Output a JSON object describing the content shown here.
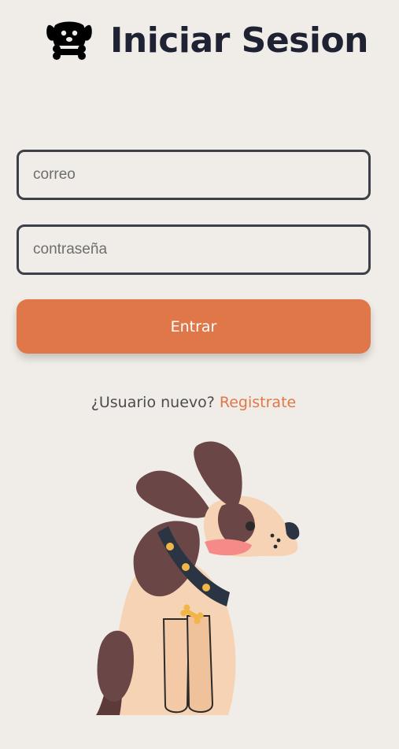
{
  "header": {
    "title": "Iniciar Sesion",
    "logo_icon": "dog-bone-icon"
  },
  "form": {
    "email_placeholder": "correo",
    "password_placeholder": "contraseña",
    "submit_label": "Entrar"
  },
  "register": {
    "prompt": "¿Usuario nuevo?",
    "link_label": "Registrate"
  },
  "illustration": {
    "icon": "dog-illustration"
  },
  "colors": {
    "accent": "#e07749",
    "background": "#f0ede8",
    "title": "#1f2232",
    "border": "#3e4049"
  }
}
